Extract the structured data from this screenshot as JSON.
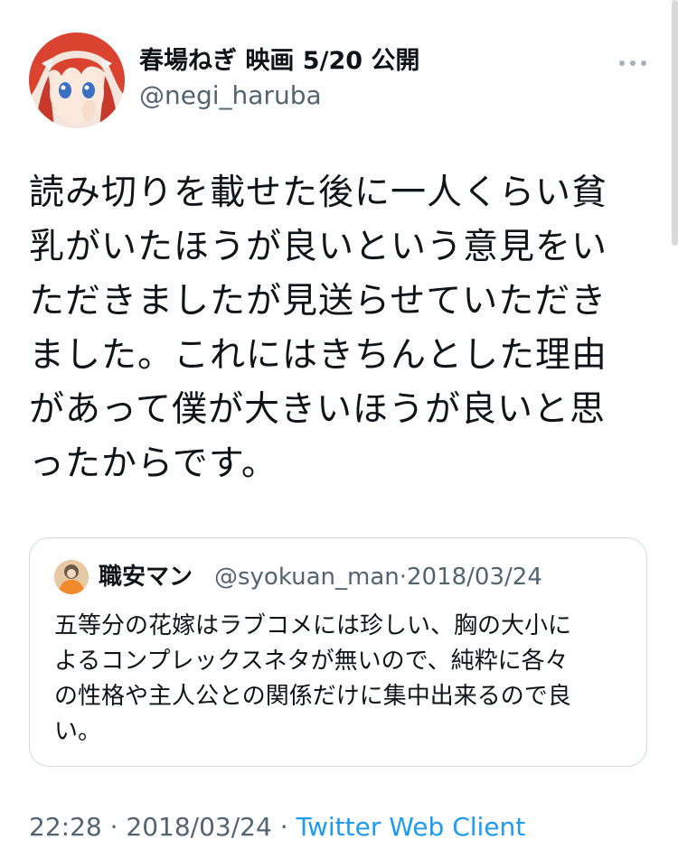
{
  "author": {
    "display_name": "春場ねぎ 映画 5/20 公開",
    "handle": "@negi_haruba"
  },
  "menu_icon": "more-horizontal-icon",
  "tweet": {
    "text": "読み切りを載せた後に一人くらい貧\n乳がいたほうが良いという意見をい\nただきましたが見送らせていただき\nました。これにはきちんとした理由\nがあって僕が大きいほうが良いと思\nったからです。"
  },
  "quoted_tweet": {
    "display_name": "職安マン",
    "handle": "@syokuan_man",
    "separator": "·",
    "date": "2018/03/24",
    "text": "五等分の花嫁はラブコメには珍しい、胸の大小に\nよるコンプレックスネタが無いので、純粋に各々\nの性格や主人公との関係だけに集中出来るので良\nい。"
  },
  "footer": {
    "time": "22:28",
    "separator1": " · ",
    "date": "2018/03/24",
    "separator2": " · ",
    "client": "Twitter Web Client"
  },
  "colors": {
    "text_primary": "#0f1419",
    "text_secondary": "#536471",
    "link": "#1d9bf0",
    "border": "#cfd9de"
  }
}
